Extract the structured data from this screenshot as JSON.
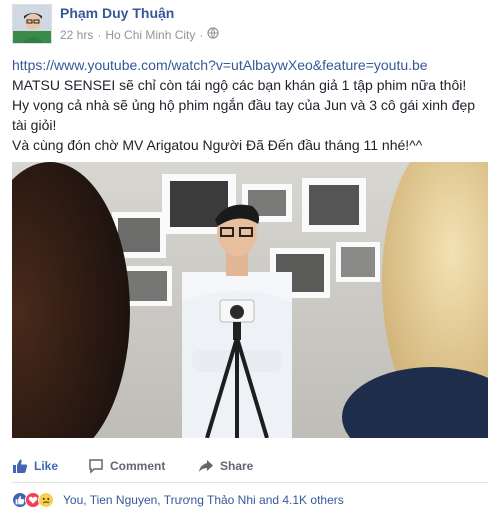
{
  "post": {
    "author": "Phạm Duy Thuận",
    "timestamp": "22 hrs",
    "location": "Ho Chi Minh City",
    "privacy_icon": "globe-icon",
    "link": "https://www.youtube.com/watch?v=utAlbaywXeo&feature=youtu.be",
    "lines": [
      "MATSU SENSEI sẽ chỉ còn tái ngộ các bạn khán giả 1 tập phim nữa thôi!",
      "Hy vọng cả nhà sẽ ủng hộ phim ngắn đầu tay của Jun và 3 cô gái xinh đẹp tài giỏi!",
      "Và cùng đón chờ MV Arigatou Người Đã Đến đầu tháng 11 nhé!^^"
    ]
  },
  "actions": {
    "like": "Like",
    "comment": "Comment",
    "share": "Share"
  },
  "reactions": {
    "icons": [
      "like-reaction-icon",
      "love-reaction-icon",
      "sad-reaction-icon"
    ],
    "summary": "You, Tien Nguyen, Trương Thảo Nhi and 4.1K others"
  },
  "colors": {
    "link": "#365899",
    "like_active": "#4267b2",
    "muted": "#90949c"
  }
}
